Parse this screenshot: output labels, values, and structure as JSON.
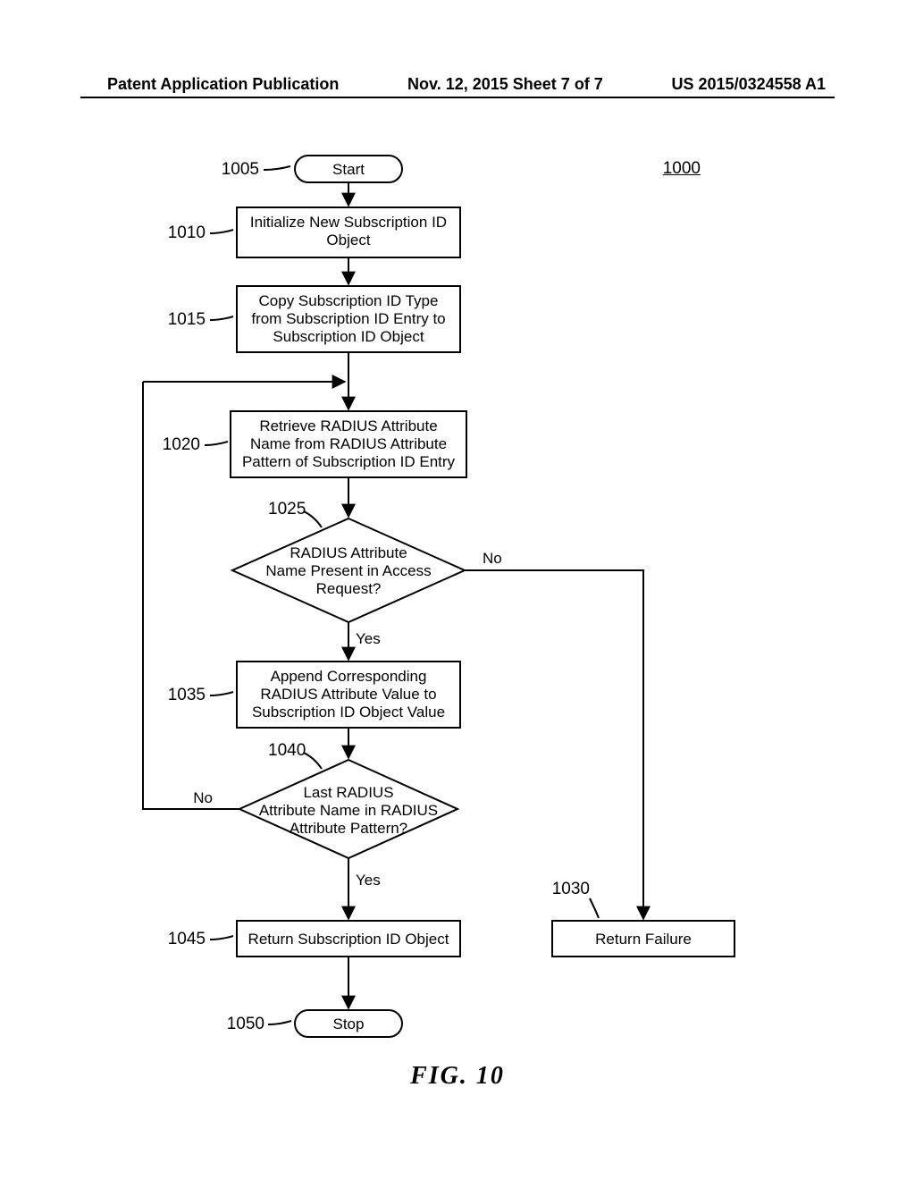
{
  "header": {
    "left": "Patent Application Publication",
    "center": "Nov. 12, 2015  Sheet 7 of 7",
    "right": "US 2015/0324558 A1"
  },
  "figure": {
    "ref": "1000",
    "label": "FIG.   10"
  },
  "nodes": {
    "start": {
      "ref": "1005",
      "text": "Start",
      "type": "terminator"
    },
    "init": {
      "ref": "1010",
      "lines": [
        "Initialize New Subscription ID",
        "Object"
      ],
      "type": "process"
    },
    "copy": {
      "ref": "1015",
      "lines": [
        "Copy Subscription ID Type",
        "from Subscription ID Entry to",
        "Subscription ID Object"
      ],
      "type": "process"
    },
    "retrieve": {
      "ref": "1020",
      "lines": [
        "Retrieve RADIUS Attribute",
        "Name from RADIUS Attribute",
        "Pattern of Subscription ID Entry"
      ],
      "type": "process"
    },
    "decision1": {
      "ref": "1025",
      "lines": [
        "RADIUS Attribute",
        "Name Present in Access",
        "Request?"
      ],
      "type": "decision",
      "yes": "Yes",
      "no": "No"
    },
    "append": {
      "ref": "1035",
      "lines": [
        "Append Corresponding",
        "RADIUS Attribute Value to",
        "Subscription ID Object Value"
      ],
      "type": "process"
    },
    "decision2": {
      "ref": "1040",
      "lines": [
        "Last RADIUS",
        "Attribute Name in RADIUS",
        "Attribute Pattern?"
      ],
      "type": "decision",
      "yes": "Yes",
      "no": "No"
    },
    "return_ok": {
      "ref": "1045",
      "lines": [
        "Return Subscription ID Object"
      ],
      "type": "process"
    },
    "return_fail": {
      "ref": "1030",
      "lines": [
        "Return Failure"
      ],
      "type": "process"
    },
    "stop": {
      "ref": "1050",
      "text": "Stop",
      "type": "terminator"
    }
  }
}
